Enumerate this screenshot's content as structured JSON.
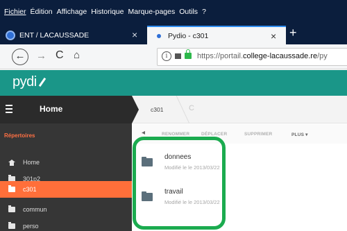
{
  "menubar": {
    "items": [
      "Fichier",
      "Édition",
      "Affichage",
      "Historique",
      "Marque-pages",
      "Outils",
      "?"
    ]
  },
  "tabs": [
    {
      "title": "ENT / LACAUSSADE",
      "close": "×"
    },
    {
      "title": "Pydio - c301",
      "close": "×"
    }
  ],
  "newtab": "+",
  "nav": {
    "back": "←",
    "forward": "→",
    "reload": "C",
    "home": "⌂",
    "info": "i",
    "url_prefix": "https://portail.",
    "url_domain": "college-lacaussade.re",
    "url_suffix": "/py"
  },
  "app": {
    "logo": "pydi",
    "accent": "#1a9688",
    "highlight": "#ff6f3a"
  },
  "sidebar": {
    "home_title": "Home",
    "section": "Répertoires",
    "items": [
      {
        "label": "Home",
        "icon": "house-icon"
      },
      {
        "label": "301p2",
        "icon": "folder-icon"
      },
      {
        "label": "c301",
        "icon": "folder-icon",
        "active": true
      },
      {
        "label": "commun",
        "icon": "folder-icon"
      },
      {
        "label": "perso",
        "icon": "folder-icon"
      }
    ]
  },
  "breadcrumb": {
    "current": "c301",
    "refresh": "C"
  },
  "toolbar": {
    "back": "◂",
    "actions": [
      "RENOMMER",
      "DÉPLACER",
      "SUPPRIMER",
      "PLUS ▾"
    ]
  },
  "files": [
    {
      "name": "donnees",
      "modified": "Modifié le le 2013/03/22"
    },
    {
      "name": "travail",
      "modified": "Modifié le le 2013/03/22"
    }
  ]
}
